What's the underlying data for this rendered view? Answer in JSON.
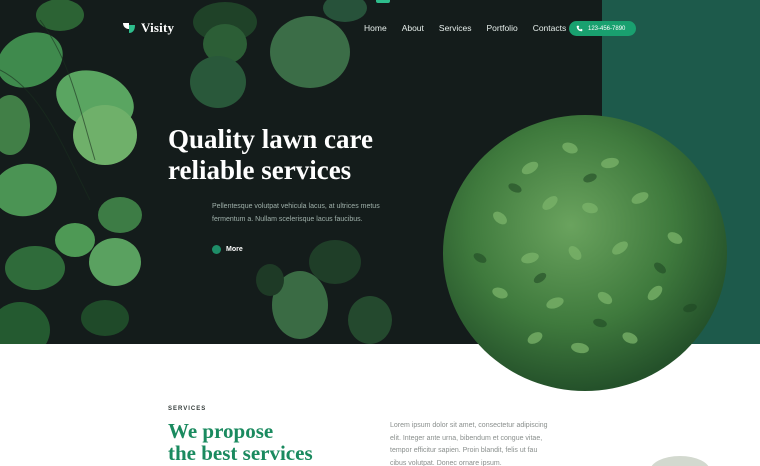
{
  "brand": {
    "name": "Visity",
    "logo_icon": "leaf-logo-icon"
  },
  "nav": {
    "items": [
      "Home",
      "About",
      "Services",
      "Portfolio",
      "Contacts"
    ],
    "active": "Home"
  },
  "phone": {
    "icon": "phone-icon",
    "number": "123-456-7890"
  },
  "hero": {
    "title_line1": "Quality lawn care",
    "title_line2": "reliable services",
    "text_line1": "Pellentesque volutpat vehicula lacus, at ultrices metus",
    "text_line2": "fermentum a. Nullam scelerisque lacus faucibus.",
    "more_label": "More"
  },
  "services": {
    "label": "SERVICES",
    "heading_line1": "We propose",
    "heading_line2": "the best services",
    "text_lines": [
      "Lorem ipsum dolor sit amet, consectetur adipiscing",
      "elit. Integer ante urna, bibendum et congue vitae,",
      "tempor efficitur sapien. Proin blandit, felis ut fau",
      "cibus volutpat. Donec ornare ipsum."
    ]
  },
  "colors": {
    "hero_bg": "#141c1b",
    "panel": "#1d5a4b",
    "accent": "#19a06f",
    "heading_green": "#1a8a5f"
  }
}
